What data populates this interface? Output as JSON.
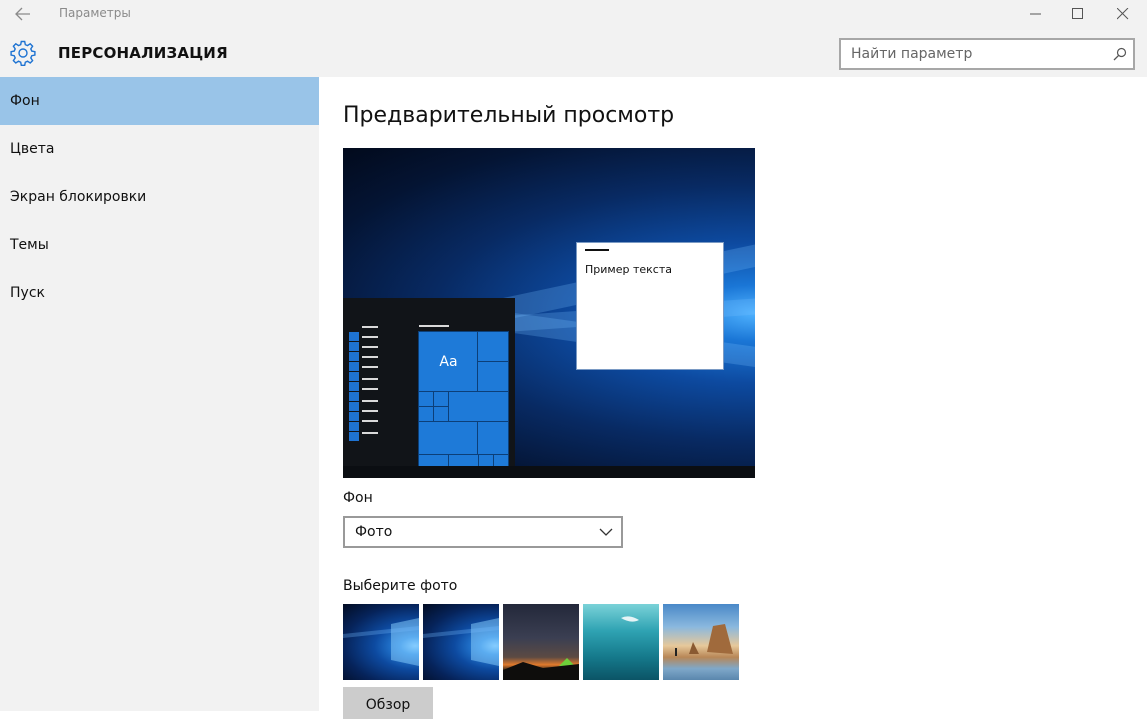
{
  "window": {
    "title": "Параметры"
  },
  "header": {
    "section_title": "ПЕРСОНАЛИЗАЦИЯ",
    "search_placeholder": "Найти параметр"
  },
  "sidebar": {
    "items": [
      {
        "label": "Фон",
        "active": true
      },
      {
        "label": "Цвета",
        "active": false
      },
      {
        "label": "Экран блокировки",
        "active": false
      },
      {
        "label": "Темы",
        "active": false
      },
      {
        "label": "Пуск",
        "active": false
      }
    ]
  },
  "main": {
    "preview_title": "Предварительный просмотр",
    "preview_sample_text": "Пример текста",
    "preview_tile_text": "Aa",
    "background_label": "Фон",
    "background_value": "Фото",
    "choose_photo_label": "Выберите фото",
    "browse_label": "Обзор"
  },
  "colors": {
    "accent": "#99c4e8",
    "sidebar_bg": "#f2f2f2",
    "tile_blue": "#1e7ad8"
  },
  "icons": [
    "back-arrow-icon",
    "minimize-icon",
    "maximize-icon",
    "close-icon",
    "gear-icon",
    "search-icon",
    "chevron-down-icon"
  ]
}
